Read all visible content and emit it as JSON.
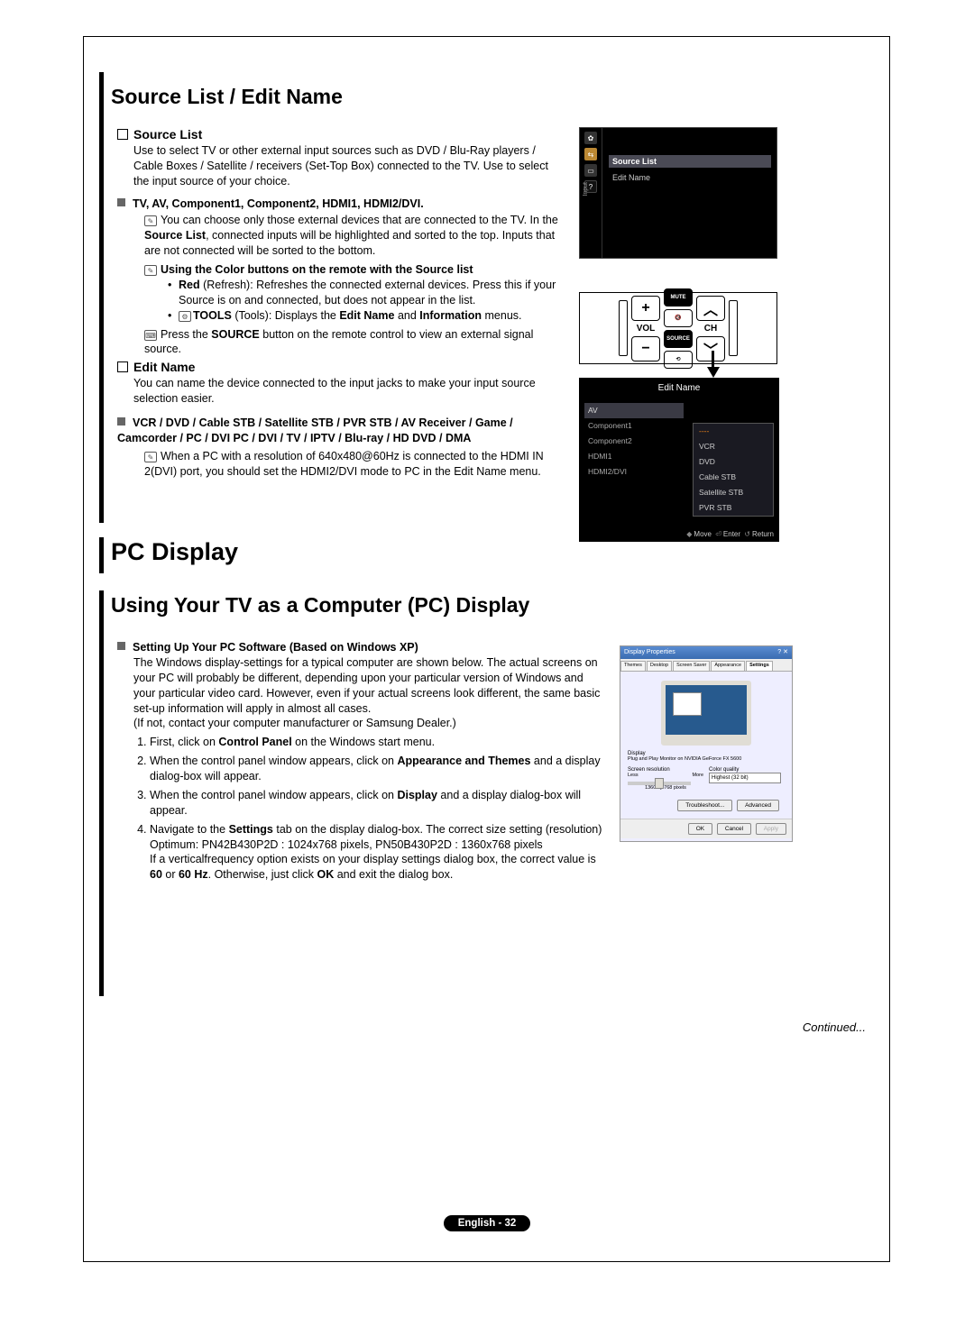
{
  "header": {
    "title1": "Source List / Edit Name",
    "title_pc": "PC Display",
    "title2": "Using Your TV as a Computer (PC) Display"
  },
  "src": {
    "h": "Source List",
    "p1": "Use to select TV or other external input sources such as DVD / Blu-Ray players / Cable Boxes / Satellite / receivers (Set-Top Box) connected to the TV. Use to select the input source of your choice.",
    "b1": "TV, AV, Component1, Component2, HDMI1, HDMI2/DVI.",
    "n1a": "You can choose only those external devices that are connected to the TV. In the ",
    "n1b": "Source List",
    "n1c": ", connected inputs will be highlighted and sorted to the top. Inputs that are not connected will be sorted to the bottom.",
    "n2": "Using the Color buttons on the remote with the Source list",
    "r1a": "Red",
    "r1b": " (Refresh): Refreshes the connected external devices. Press this if your Source is on and connected, but does not appear in the list.",
    "t1a": "TOOLS",
    "t1b": " (Tools): Displays the ",
    "t1c": "Edit Name",
    "t1d": " and ",
    "t1e": "Information",
    "t1f": " menus.",
    "p2a": "Press the ",
    "p2b": "SOURCE",
    "p2c": " button on the remote control to view an external signal source."
  },
  "edit": {
    "h": "Edit Name",
    "p1": "You can name the device connected to the input jacks to make your input source selection easier.",
    "b1": "VCR / DVD / Cable STB / Satellite STB / PVR STB / AV Receiver / Game / Camcorder / PC / DVI PC / DVI / TV / IPTV / Blu-ray / HD DVD / DMA",
    "n1": "When a PC with a resolution of 640x480@60Hz is connected to the HDMI IN 2(DVI) port, you should set the HDMI2/DVI mode to PC in the Edit Name menu."
  },
  "tv": {
    "input_label": "Input",
    "source_list": "Source List",
    "edit_name": "Edit Name"
  },
  "remote": {
    "plus": "+",
    "minus": "−",
    "mute": "MUTE",
    "source": "SOURCE",
    "vol": "VOL",
    "ch": "CH",
    "up": "︿",
    "down": "﹀",
    "speaker": "🔇",
    "loop": "⟲"
  },
  "osd": {
    "title": "Edit Name",
    "left": [
      "AV",
      "Component1",
      "Component2",
      "HDMI1",
      "HDMI2/DVI"
    ],
    "right": [
      "----",
      "VCR",
      "DVD",
      "Cable STB",
      "Satellite STB",
      "PVR STB"
    ],
    "move": "Move",
    "enter": "Enter",
    "return": "Return"
  },
  "pc": {
    "h": "Setting Up Your PC Software (Based on Windows XP)",
    "p1": "The Windows display-settings for a typical computer are shown below. The actual screens on your PC will probably be different, depending upon your particular version of Windows and your particular video card. However, even if your actual screens look different, the same basic set-up information will apply in almost all cases.",
    "p1b": "(If not, contact your computer manufacturer or Samsung Dealer.)",
    "s1a": "First, click on ",
    "s1b": "Control Panel",
    "s1c": " on the Windows start menu.",
    "s2a": "When the control panel window appears, click on ",
    "s2b": "Appearance and Themes",
    "s2c": " and a display dialog-box will appear.",
    "s3a": "When the control panel window appears, click on ",
    "s3b": "Display",
    "s3c": " and a display dialog-box will appear.",
    "s4a": "Navigate to the ",
    "s4b": "Settings",
    "s4c": " tab on the display dialog-box. The correct size setting (resolution) Optimum: PN42B430P2D : 1024x768 pixels, PN50B430P2D : 1360x768 pixels",
    "s4d": "If a verticalfrequency option exists on your display settings dialog box, the correct value is ",
    "s4e": "60",
    "s4f": " or ",
    "s4g": "60 Hz",
    "s4h": ". Otherwise, just click ",
    "s4i": "OK",
    "s4j": " and exit the dialog box."
  },
  "xp": {
    "title": "Display Properties",
    "tabs": [
      "Themes",
      "Desktop",
      "Screen Saver",
      "Appearance",
      "Settings"
    ],
    "display": "Display",
    "monitor": "Plug and Play Monitor on NVIDIA GeForce FX 5600",
    "res": "Screen resolution",
    "less": "Less",
    "more": "More",
    "resval": "1360 by 768 pixels",
    "color": "Color quality",
    "colorval": "Highest (32 bit)",
    "troubleshoot": "Troubleshoot...",
    "advanced": "Advanced",
    "ok": "OK",
    "cancel": "Cancel",
    "apply": "Apply"
  },
  "continued": "Continued...",
  "footer": {
    "lang": "English - 32"
  }
}
